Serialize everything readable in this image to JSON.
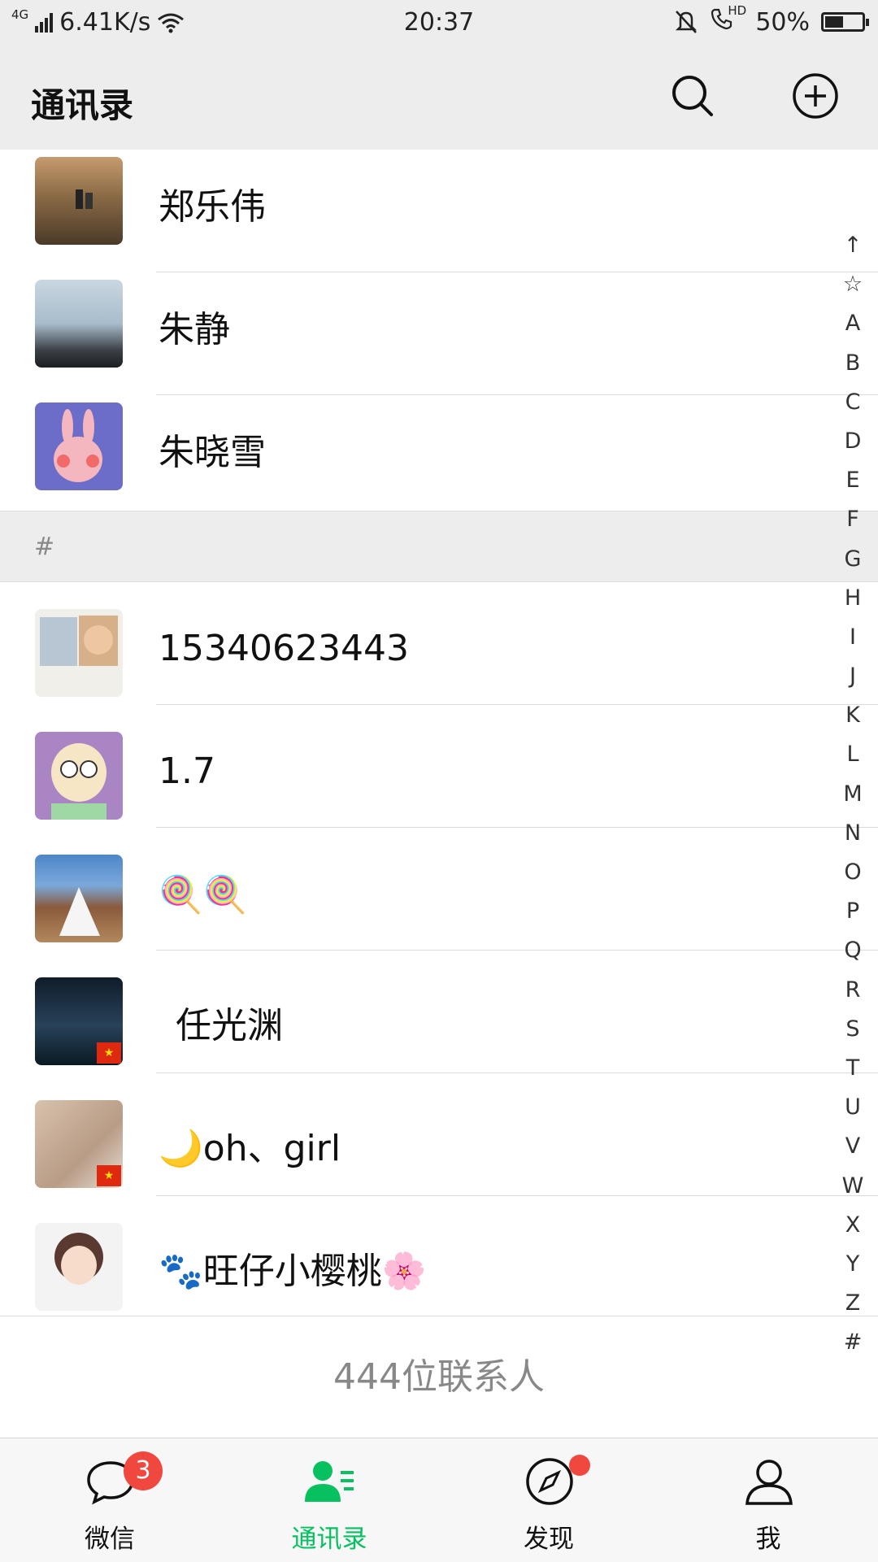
{
  "status_bar": {
    "network": "4G",
    "speed": "6.41K/s",
    "time": "20:37",
    "hd_label": "HD",
    "battery": "50%",
    "battery_level": 0.5
  },
  "header": {
    "title": "通讯录",
    "search_icon": "search-icon",
    "add_icon": "add-circle-icon"
  },
  "contacts_top": [
    {
      "name": "郑乐伟"
    },
    {
      "name": "朱静"
    },
    {
      "name": "朱晓雪"
    }
  ],
  "section_header": "#",
  "contacts_hash": [
    {
      "name": "15340623443"
    },
    {
      "name": "1.7"
    },
    {
      "name": "🍭🍭"
    },
    {
      "name": "任光渊",
      "flag": true
    },
    {
      "name": "🌙oh、girl",
      "flag": true
    },
    {
      "name": "🐾旺仔小樱桃🌸"
    }
  ],
  "contact_count": "444位联系人",
  "index_letters": [
    "↑",
    "☆",
    "A",
    "B",
    "C",
    "D",
    "E",
    "F",
    "G",
    "H",
    "I",
    "J",
    "K",
    "L",
    "M",
    "N",
    "O",
    "P",
    "Q",
    "R",
    "S",
    "T",
    "U",
    "V",
    "W",
    "X",
    "Y",
    "Z",
    "#"
  ],
  "tabbar": {
    "tabs": [
      {
        "label": "微信",
        "icon": "chat-icon",
        "badge": "3"
      },
      {
        "label": "通讯录",
        "icon": "contacts-icon",
        "active": true
      },
      {
        "label": "发现",
        "icon": "compass-icon",
        "dot": true
      },
      {
        "label": "我",
        "icon": "profile-icon"
      }
    ]
  },
  "colors": {
    "accent": "#07c160",
    "badge": "#f0483e",
    "background": "#ededed"
  }
}
